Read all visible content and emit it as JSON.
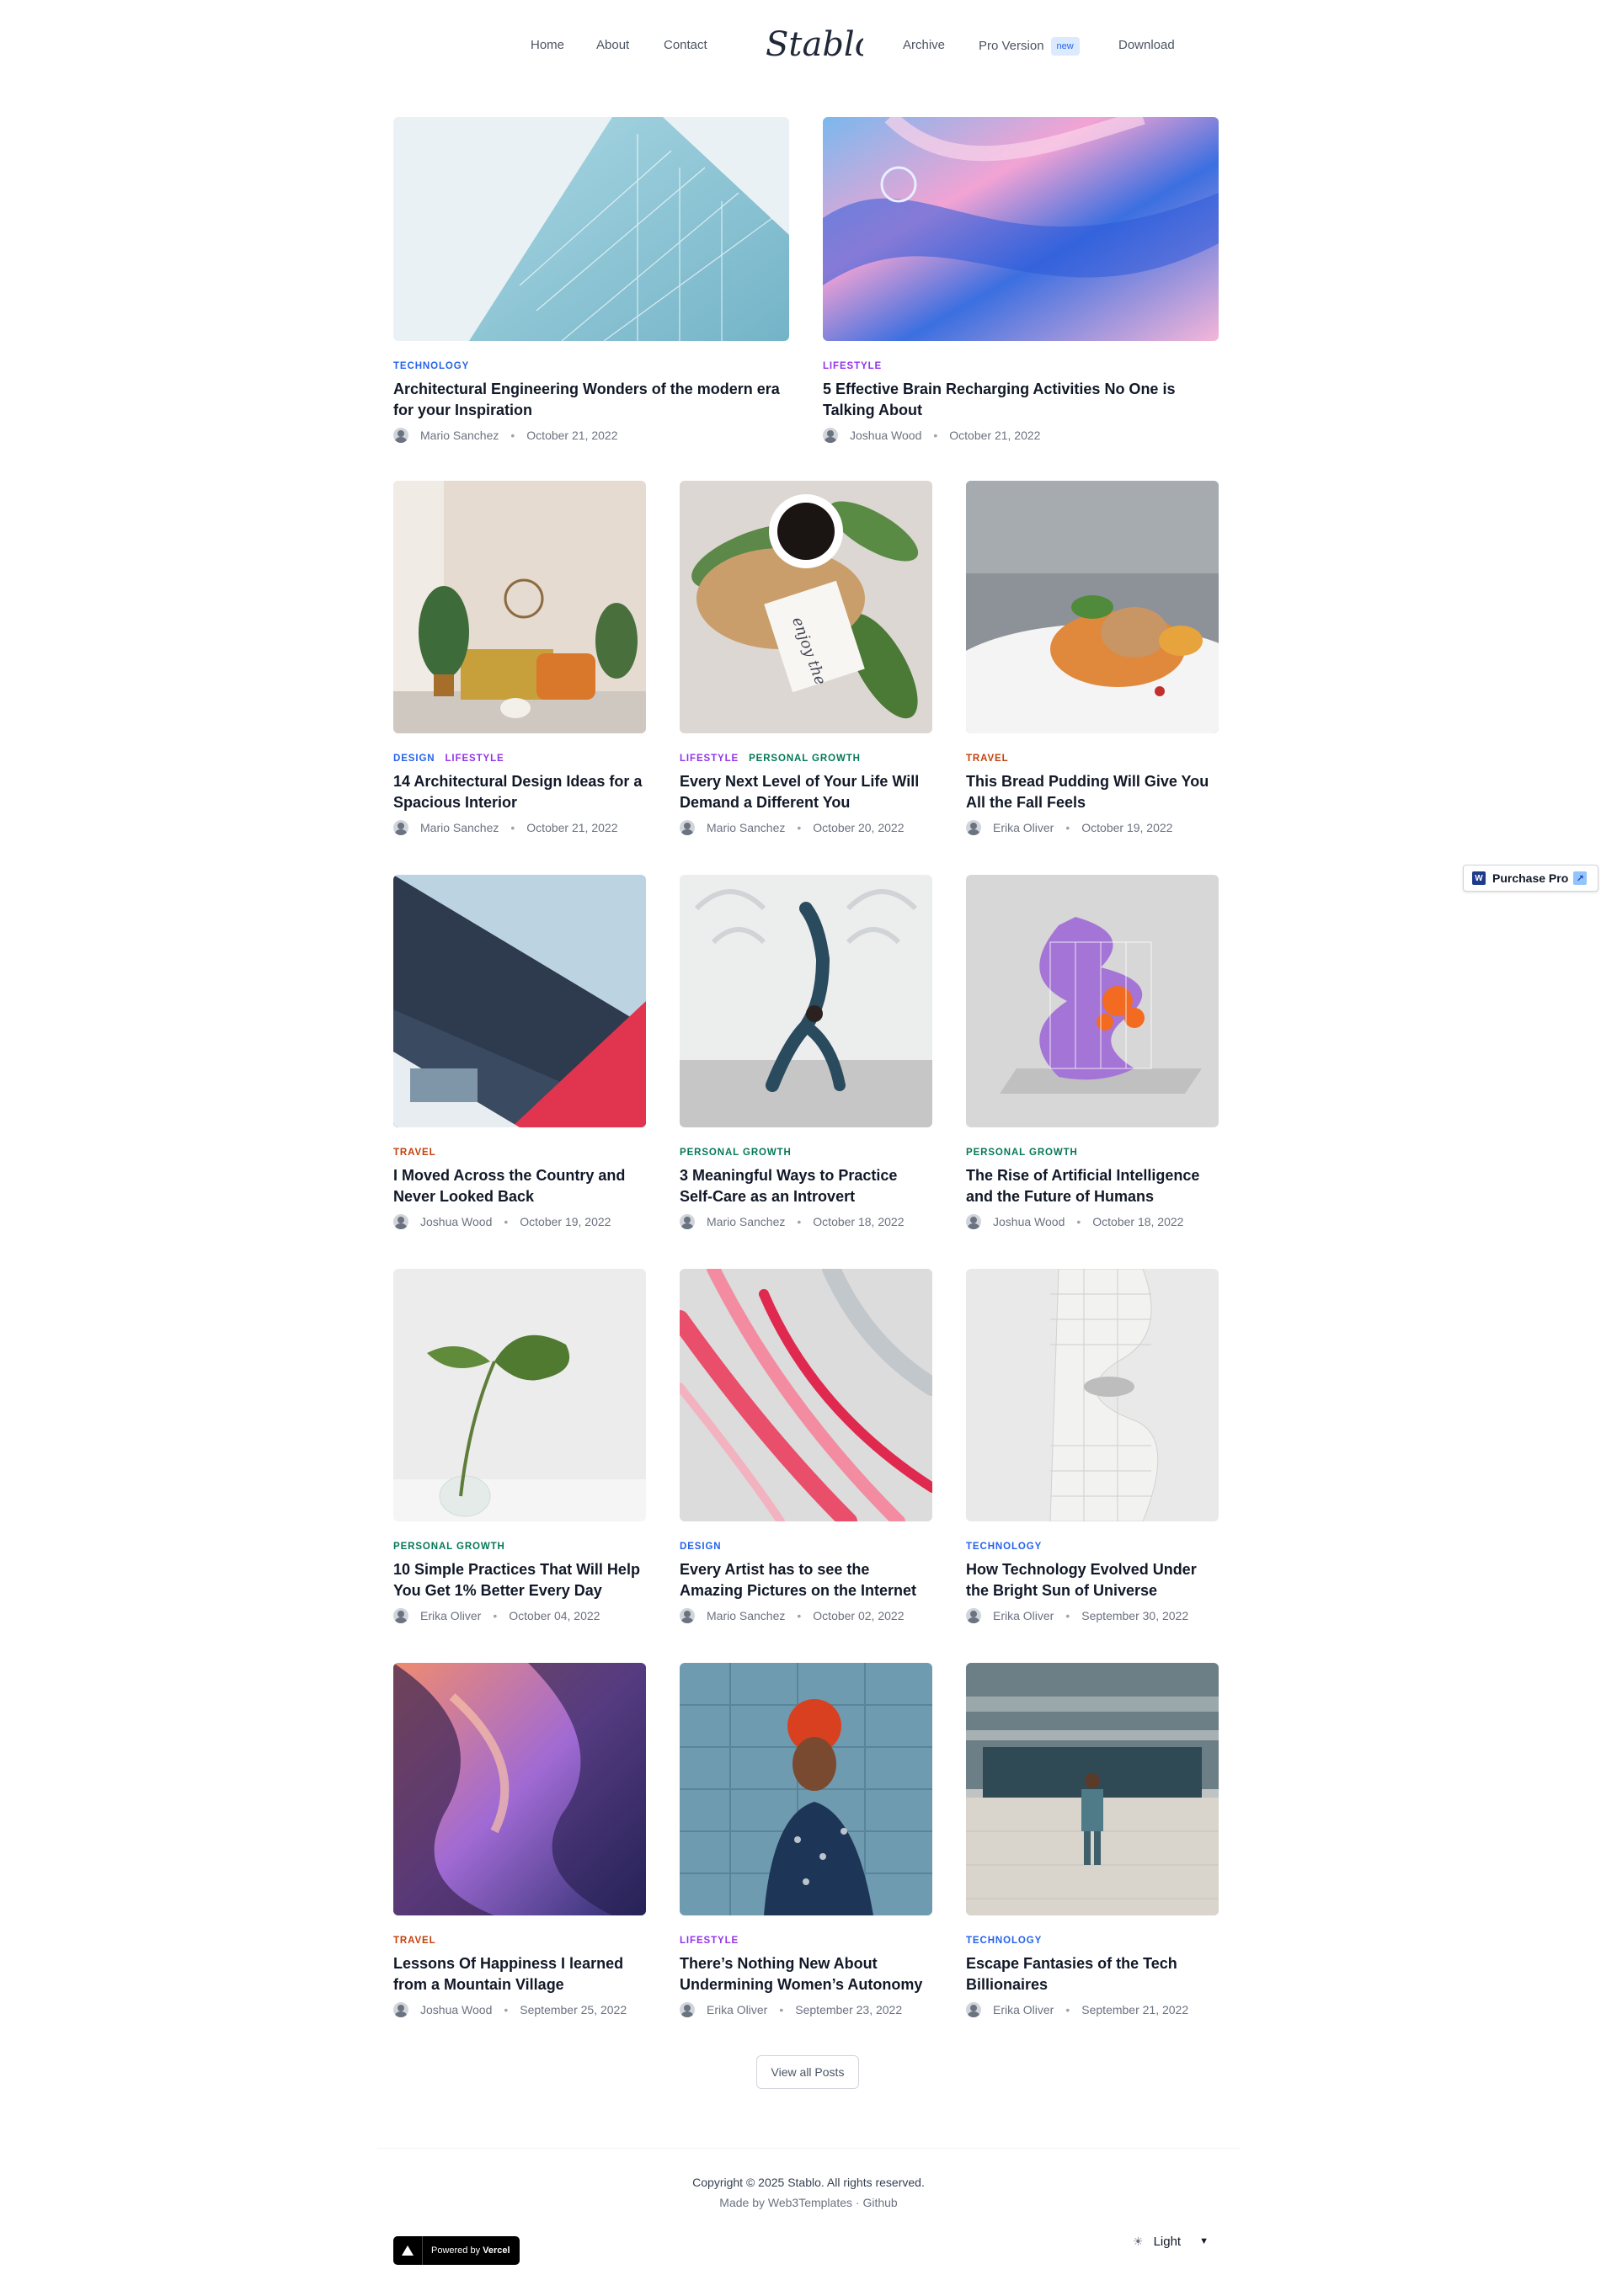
{
  "nav": {
    "left": [
      "Home",
      "About",
      "Contact"
    ],
    "right": [
      "Archive",
      "Pro Version",
      "Download"
    ],
    "new_badge": "new",
    "logo": "Stablo"
  },
  "posts": [
    {
      "cats": [
        {
          "label": "Technology",
          "color": "#2563eb"
        }
      ],
      "title": "Architectural Engineering Wonders of the modern era for your Inspiration",
      "author": "Mario Sanchez",
      "date": "October 21, 2022"
    },
    {
      "cats": [
        {
          "label": "Lifestyle",
          "color": "#9333ea"
        }
      ],
      "title": "5 Effective Brain Recharging Activities No One is Talking About",
      "author": "Joshua Wood",
      "date": "October 21, 2022"
    },
    {
      "cats": [
        {
          "label": "Design",
          "color": "#2563eb"
        },
        {
          "label": "Lifestyle",
          "color": "#9333ea"
        }
      ],
      "title": "14 Architectural Design Ideas for a Spacious Interior",
      "author": "Mario Sanchez",
      "date": "October 21, 2022"
    },
    {
      "cats": [
        {
          "label": "Lifestyle",
          "color": "#9333ea"
        },
        {
          "label": "Personal Growth",
          "color": "#047857"
        }
      ],
      "title": "Every Next Level of Your Life Will Demand a Different You",
      "author": "Mario Sanchez",
      "date": "October 20, 2022"
    },
    {
      "cats": [
        {
          "label": "Travel",
          "color": "#c2410c"
        }
      ],
      "title": "This Bread Pudding Will Give You All the Fall Feels",
      "author": "Erika Oliver",
      "date": "October 19, 2022"
    },
    {
      "cats": [
        {
          "label": "Travel",
          "color": "#c2410c"
        }
      ],
      "title": "I Moved Across the Country and Never Looked Back",
      "author": "Joshua Wood",
      "date": "October 19, 2022"
    },
    {
      "cats": [
        {
          "label": "Personal Growth",
          "color": "#047857"
        }
      ],
      "title": "3 Meaningful Ways to Practice Self-Care as an Introvert",
      "author": "Mario Sanchez",
      "date": "October 18, 2022"
    },
    {
      "cats": [
        {
          "label": "Personal Growth",
          "color": "#047857"
        }
      ],
      "title": "The Rise of Artificial Intelligence and the Future of Humans",
      "author": "Joshua Wood",
      "date": "October 18, 2022"
    },
    {
      "cats": [
        {
          "label": "Personal Growth",
          "color": "#047857"
        }
      ],
      "title": "10 Simple Practices That Will Help You Get 1% Better Every Day",
      "author": "Erika Oliver",
      "date": "October 04, 2022"
    },
    {
      "cats": [
        {
          "label": "Design",
          "color": "#2563eb"
        }
      ],
      "title": "Every Artist has to see the Amazing Pictures on the Internet",
      "author": "Mario Sanchez",
      "date": "October 02, 2022"
    },
    {
      "cats": [
        {
          "label": "Technology",
          "color": "#2563eb"
        }
      ],
      "title": "How Technology Evolved Under the Bright Sun of Universe",
      "author": "Erika Oliver",
      "date": "September 30, 2022"
    },
    {
      "cats": [
        {
          "label": "Travel",
          "color": "#c2410c"
        }
      ],
      "title": "Lessons Of Happiness I learned from a Mountain Village",
      "author": "Joshua Wood",
      "date": "September 25, 2022"
    },
    {
      "cats": [
        {
          "label": "Lifestyle",
          "color": "#9333ea"
        }
      ],
      "title": "There’s Nothing New About Undermining Women’s Autonomy",
      "author": "Erika Oliver",
      "date": "September 23, 2022"
    },
    {
      "cats": [
        {
          "label": "Technology",
          "color": "#2563eb"
        }
      ],
      "title": "Escape Fantasies of the Tech Billionaires",
      "author": "Erika Oliver",
      "date": "September 21, 2022"
    }
  ],
  "view_all": "View all Posts",
  "purchase_pro": "Purchase Pro",
  "footer": {
    "copyright": "Copyright © 2025 Stablo. All rights reserved.",
    "madeby": "Made by Web3Templates · Github",
    "powered": "Powered by",
    "vercel": "Vercel",
    "theme": "Light"
  }
}
